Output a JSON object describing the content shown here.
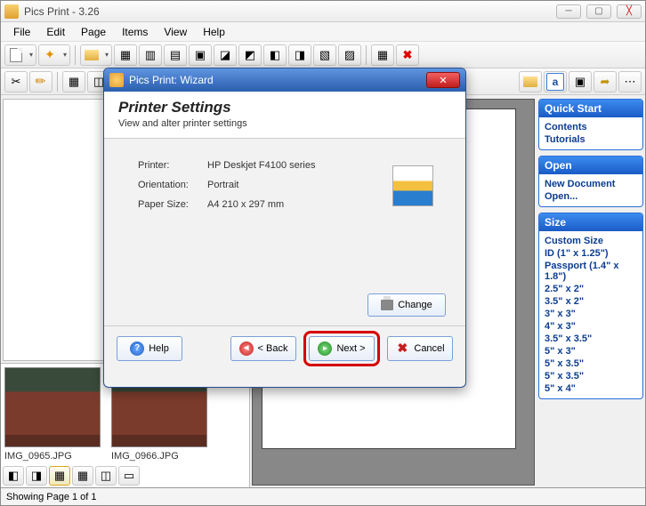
{
  "window": {
    "title": "Pics Print - 3.26",
    "controls": {
      "min": "─",
      "max": "▢",
      "close": "╳"
    }
  },
  "menu": [
    "File",
    "Edit",
    "Page",
    "Items",
    "View",
    "Help"
  ],
  "thumbs": [
    {
      "label": "IMG_0965.JPG"
    },
    {
      "label": "IMG_0966.JPG"
    }
  ],
  "panels": {
    "quickstart": {
      "title": "Quick Start",
      "links": [
        "Contents",
        "Tutorials"
      ]
    },
    "open": {
      "title": "Open",
      "links": [
        "New Document",
        "Open..."
      ]
    },
    "size": {
      "title": "Size",
      "items": [
        "Custom Size",
        "ID (1\" x 1.25\")",
        "Passport (1.4\" x 1.8\")",
        "2.5\" x 2\"",
        "3.5\" x 2\"",
        "3\" x 3\"",
        "4\" x 3\"",
        "3.5\" x 3.5\"",
        "5\" x 3\"",
        "5\" x 3.5\"",
        "5\" x 3.5\"",
        "5\" x 4\""
      ]
    }
  },
  "statusbar": "Showing Page 1 of 1",
  "wizard": {
    "title": "Pics Print: Wizard",
    "close": "✕",
    "heading": "Printer Settings",
    "subheading": "View and alter printer settings",
    "rows": [
      {
        "label": "Printer:",
        "value": "HP Deskjet F4100 series"
      },
      {
        "label": "Orientation:",
        "value": "Portrait"
      },
      {
        "label": "Paper Size:",
        "value": "A4 210 x 297 mm"
      }
    ],
    "change": "Change",
    "buttons": {
      "help": "Help",
      "back": "< Back",
      "next": "Next >",
      "cancel": "Cancel"
    }
  }
}
